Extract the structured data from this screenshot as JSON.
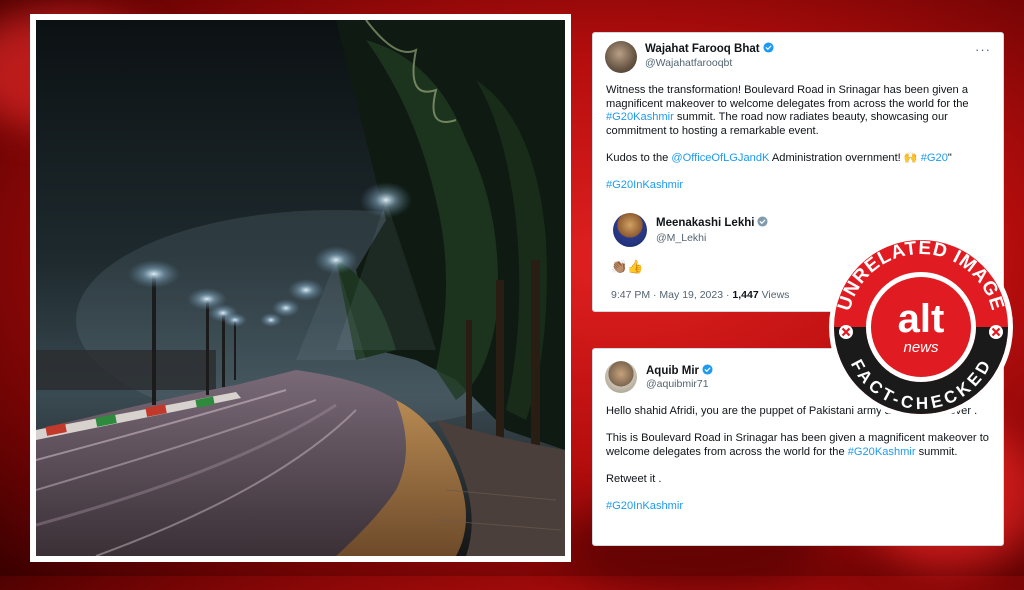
{
  "tweet1": {
    "author_name": "Wajahat Farooq Bhat",
    "author_handle": "@Wajahatfarooqbt",
    "more_label": "···",
    "line1": "Witness the transformation! Boulevard Road in Srinagar has been given a magnificent makeover to welcome delegates from across the world for the ",
    "hashtag_g20kashmir": "#G20Kashmir",
    "line2": " summit. The road now radiates beauty, showcasing our commitment to hosting a remarkable event.",
    "kudos_prefix": "Kudos to the ",
    "mention_lg": "@OfficeOfLGJandK",
    "kudos_middle": " Administration overnment! 🙌 ",
    "hashtag_g20": "#G20",
    "kudos_suffix": "\"",
    "hashtag_g20inkashmir": "#G20InKashmir",
    "quote_name": "Meenakashi Lekhi",
    "quote_handle": "@M_Lekhi",
    "emoji": "👏🏽👍",
    "time": "9:47 PM · May 19, 2023 · ",
    "views_count": "1,447",
    "views_label": " Views"
  },
  "tweet2": {
    "author_name": "Aquib Mir",
    "author_handle": "@aquibmir71",
    "para1": "Hello shahid Afridi, you are the puppet of Pakistani army and terrorist lover .",
    "para2_prefix": "This is Boulevard Road in Srinagar has been given a magnificent makeover to welcome delegates from across the world for the ",
    "hashtag_g20kashmir": "#G20Kashmir",
    "para2_suffix": " summit.",
    "para3": "Retweet it .",
    "hashtag_g20inkashmir": "#G20InKashmir"
  },
  "stamp": {
    "top_text": "UNRELATED IMAGE",
    "bottom_text": "FACT-CHECKED",
    "logo_text": "alt",
    "logo_sub": "news"
  },
  "colors": {
    "link": "#1d9bf0",
    "verified": "#1d9bf0",
    "stamp_red": "#e11b22",
    "stamp_dark": "#1a1a1a"
  }
}
